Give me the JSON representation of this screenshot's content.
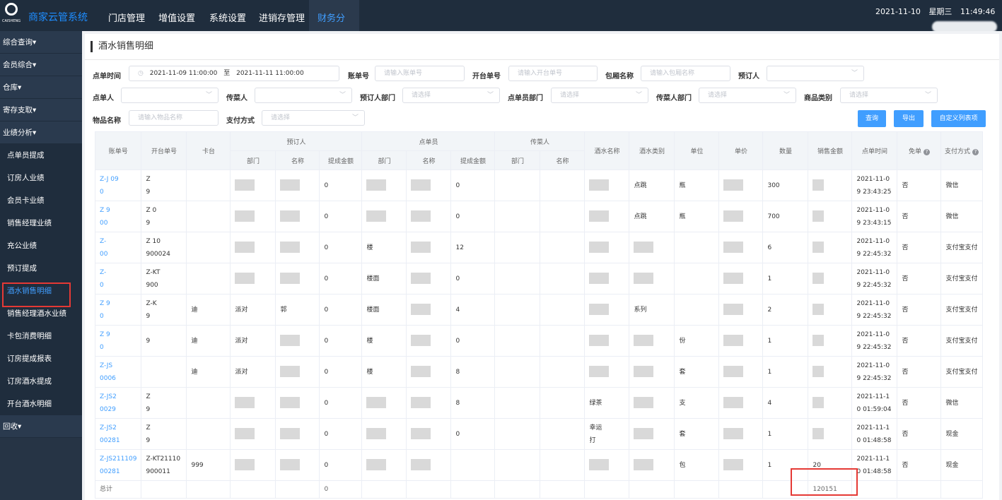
{
  "app": {
    "title": "商家云管系统",
    "logo_text": "CAISHENG"
  },
  "topnav": [
    "门店管理",
    "增值设置",
    "系统设置",
    "进销存管理",
    "财务分析"
  ],
  "topnav_active": "财务分析",
  "datetime": {
    "date": "2021-11-10",
    "weekday": "星期三",
    "time": "11:49:46"
  },
  "sidebar": {
    "groups_top": [
      "综合查询",
      "会员综合",
      "仓库",
      "寄存支取",
      "业绩分析"
    ],
    "items": [
      "点单员提成",
      "订房人业绩",
      "会员卡业绩",
      "销售经理业绩",
      "充公业绩",
      "预订提成",
      "酒水销售明细",
      "销售经理酒水业绩",
      "卡包消费明细",
      "订房提成报表",
      "订房酒水提成",
      "开台酒水明细"
    ],
    "groups_bottom": [
      "回收"
    ],
    "active": "酒水销售明细",
    "caret": "▾"
  },
  "page_title": "酒水销售明细",
  "filters": {
    "order_time_label": "点单时间",
    "date_start": "2021-11-09 11:00:00",
    "date_sep": "至",
    "date_end": "2021-11-11 11:00:00",
    "bill_no_label": "账单号",
    "bill_no_placeholder": "请输入账单号",
    "open_no_label": "开台单号",
    "open_no_placeholder": "请输入开台单号",
    "room_label": "包厢名称",
    "room_placeholder": "请输入包厢名称",
    "booker_label": "预订人",
    "orderer_label": "点单人",
    "server_label": "传菜人",
    "booker_dept_label": "预订人部门",
    "booker_dept_placeholder": "请选择",
    "orderer_dept_label": "点单员部门",
    "orderer_dept_placeholder": "请选择",
    "server_dept_label": "传菜人部门",
    "server_dept_placeholder": "请选择",
    "category_label": "商品类别",
    "category_placeholder": "请选择",
    "item_name_label": "物品名称",
    "item_name_placeholder": "请输入物品名称",
    "pay_label": "支付方式",
    "pay_placeholder": "请选择"
  },
  "buttons": {
    "query": "查询",
    "export": "导出",
    "custom_columns": "自定义列表项"
  },
  "table": {
    "group_headers": {
      "booker": "预订人",
      "orderer": "点单员",
      "server": "传菜人"
    },
    "headers": {
      "bill_no": "账单号",
      "open_no": "开台单号",
      "table": "卡台",
      "dept": "部门",
      "name": "名称",
      "commission": "提成金额",
      "drink_name": "酒水名称",
      "drink_type": "酒水类别",
      "unit": "单位",
      "price": "单价",
      "qty": "数量",
      "amount": "销售金额",
      "time": "点单时间",
      "free": "免单",
      "pay": "支付方式"
    },
    "rows": [
      {
        "bill": "Z-J  09\n0",
        "open": "Z  \n9",
        "table": "",
        "bdept": "",
        "bname": "",
        "bcomm": "0",
        "odept": "",
        "oname": "",
        "ocomm": "0",
        "drink": "",
        "dtype": "点跳",
        "unit": "瓶",
        "qty": "300",
        "amount": "",
        "time1": "2021-11-0",
        "time2": "9 23:43:25",
        "free": "否",
        "pay": "微信"
      },
      {
        "bill": "Z   9\n00",
        "open": "Z   0\n9",
        "table": "",
        "bdept": "",
        "bname": "",
        "bcomm": "0",
        "odept": "",
        "oname": "",
        "ocomm": "0",
        "drink": "",
        "dtype": "点跳",
        "unit": "瓶",
        "qty": "700",
        "amount": "",
        "time1": "2021-11-0",
        "time2": "9 23:43:15",
        "free": "否",
        "pay": "微信"
      },
      {
        "bill": "Z-\n00",
        "open": "Z   10\n900024",
        "table": "",
        "bdept": "",
        "bname": "",
        "bcomm": "0",
        "odept": "楼",
        "oname": "",
        "ocomm": "12",
        "drink": "",
        "dtype": "",
        "unit": "",
        "qty": "6",
        "amount": "",
        "time1": "2021-11-0",
        "time2": "9 22:45:32",
        "free": "否",
        "pay": "支付宝支付"
      },
      {
        "bill": "Z-\n0",
        "open": "Z-KT\n900",
        "table": "",
        "bdept": "",
        "bname": "",
        "bcomm": "0",
        "odept": "楼面",
        "oname": "",
        "ocomm": "0",
        "drink": "",
        "dtype": "",
        "unit": "",
        "qty": "1",
        "amount": "",
        "time1": "2021-11-0",
        "time2": "9 22:45:32",
        "free": "否",
        "pay": "支付宝支付"
      },
      {
        "bill": "Z   9\n0",
        "open": "Z-K\n9",
        "table": "迪",
        "bdept": "派对",
        "bname": "郭",
        "bcomm": "0",
        "odept": "楼面",
        "oname": "",
        "ocomm": "4",
        "drink": "",
        "dtype": "系列",
        "unit": "",
        "qty": "2",
        "amount": "",
        "time1": "2021-11-0",
        "time2": "9 22:45:32",
        "free": "否",
        "pay": "支付宝支付"
      },
      {
        "bill": "Z   9\n0",
        "open": "\n9",
        "table": "迪",
        "bdept": "派对",
        "bname": "",
        "bcomm": "0",
        "odept": "楼",
        "oname": "",
        "ocomm": "0",
        "drink": "",
        "dtype": "",
        "unit": "份",
        "qty": "1",
        "amount": "",
        "time1": "2021-11-0",
        "time2": "9 22:45:32",
        "free": "否",
        "pay": "支付宝支付"
      },
      {
        "bill": "Z-JS\n0006",
        "open": "\n",
        "table": "迪",
        "bdept": "派对",
        "bname": "",
        "bcomm": "0",
        "odept": "楼",
        "oname": "",
        "ocomm": "8",
        "drink": "",
        "dtype": "",
        "unit": "套",
        "qty": "1",
        "amount": "",
        "time1": "2021-11-0",
        "time2": "9 22:45:32",
        "free": "否",
        "pay": "支付宝支付"
      },
      {
        "bill": "Z-JS2\n0029",
        "open": "Z\n9",
        "table": "",
        "bdept": "",
        "bname": "",
        "bcomm": "0",
        "odept": "",
        "oname": "",
        "ocomm": "8",
        "drink": "绿茶",
        "dtype": "",
        "unit": "支",
        "qty": "4",
        "amount": "",
        "time1": "2021-11-1",
        "time2": "0 01:59:04",
        "free": "否",
        "pay": "微信"
      },
      {
        "bill": "Z-JS2\n00281",
        "open": "Z\n9",
        "table": "",
        "bdept": "",
        "bname": "",
        "bcomm": "0",
        "odept": "",
        "oname": "",
        "ocomm": "0",
        "drink": "幸运\n打",
        "dtype": "",
        "unit": "套",
        "qty": "1",
        "amount": "",
        "time1": "2021-11-1",
        "time2": "0 01:48:58",
        "free": "否",
        "pay": "现金"
      },
      {
        "bill": "Z-JS211109\n00281",
        "open": "Z-KT21110\n900011",
        "table": "999",
        "bdept": "",
        "bname": "",
        "bcomm": "0",
        "odept": "",
        "oname": "",
        "ocomm": "",
        "drink": "",
        "dtype": "",
        "unit": "包",
        "qty": "1",
        "amount": "20",
        "time1": "2021-11-1",
        "time2": "0 01:48:58",
        "free": "否",
        "pay": "现金"
      }
    ],
    "total_label": "总计",
    "total_booker_commission": "0",
    "total_amount": "120151"
  },
  "colors": {
    "topbar": "#1f2d3d",
    "sidebar": "#263445",
    "accent": "#409eff",
    "highlight": "#e53935"
  },
  "icons": {
    "calendar": "calendar-icon",
    "chevron": "chevron-down-icon",
    "help": "help-circle-icon"
  }
}
